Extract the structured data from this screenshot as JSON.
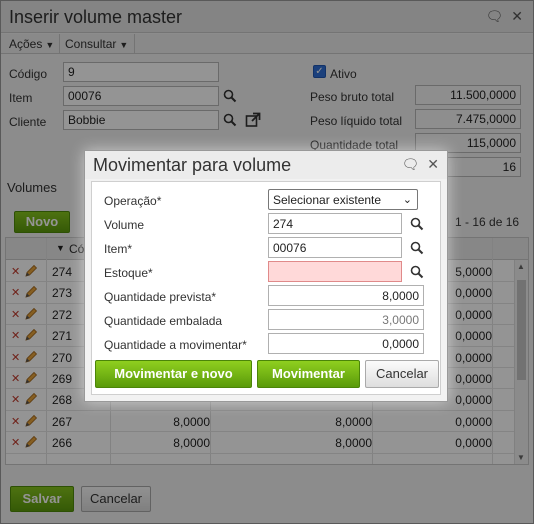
{
  "master": {
    "title": "Inserir volume master",
    "menu": {
      "acoes": "Ações",
      "consultar": "Consultar"
    },
    "fields": {
      "codigo_label": "Código",
      "codigo_value": "9",
      "item_label": "Item",
      "item_value": "00076",
      "cliente_label": "Cliente",
      "cliente_value": "Bobbie",
      "ativo_label": "Ativo",
      "peso_bruto_label": "Peso bruto total",
      "peso_bruto_value": "11.500,0000",
      "peso_liquido_label": "Peso líquido total",
      "peso_liquido_value": "7.475,0000",
      "quantidade_total_label": "Quantidade total",
      "quantidade_total_value": "115,0000",
      "count_value": "16"
    },
    "volumes": {
      "section_title": "Volumes",
      "novo_button": "Novo",
      "pagination": "1 - 16 de 16",
      "sort_header": "Có",
      "rows": [
        {
          "id": "274",
          "c2": "",
          "c3": "",
          "c4": "5,0000"
        },
        {
          "id": "273",
          "c2": "",
          "c3": "",
          "c4": "0,0000"
        },
        {
          "id": "272",
          "c2": "",
          "c3": "",
          "c4": "0,0000"
        },
        {
          "id": "271",
          "c2": "",
          "c3": "",
          "c4": "0,0000"
        },
        {
          "id": "270",
          "c2": "",
          "c3": "",
          "c4": "0,0000"
        },
        {
          "id": "269",
          "c2": "",
          "c3": "",
          "c4": "0,0000"
        },
        {
          "id": "268",
          "c2": "",
          "c3": "",
          "c4": "0,0000"
        },
        {
          "id": "267",
          "c2": "8,0000",
          "c3": "8,0000",
          "c4": "0,0000"
        },
        {
          "id": "266",
          "c2": "8,0000",
          "c3": "8,0000",
          "c4": "0,0000"
        }
      ]
    },
    "footer": {
      "salvar": "Salvar",
      "cancelar": "Cancelar"
    }
  },
  "modal": {
    "title": "Movimentar para volume",
    "operacao_label": "Operação*",
    "operacao_value": "Selecionar existente",
    "volume_label": "Volume",
    "volume_value": "274",
    "item_label": "Item*",
    "item_value": "00076",
    "estoque_label": "Estoque*",
    "estoque_value": "",
    "qtd_prevista_label": "Quantidade prevista*",
    "qtd_prevista_value": "8,0000",
    "qtd_embalada_label": "Quantidade embalada",
    "qtd_embalada_value": "3,0000",
    "qtd_movimentar_label": "Quantidade a movimentar*",
    "qtd_movimentar_value": "0,0000",
    "btn_movimentar_novo": "Movimentar e novo",
    "btn_movimentar": "Movimentar",
    "btn_cancelar": "Cancelar"
  },
  "icons": {
    "chat": "chat-bubble-icon",
    "close": "close-icon",
    "lookup": "magnifier-icon",
    "external": "external-link-icon",
    "delete": "delete-x-icon",
    "edit": "pencil-icon"
  }
}
